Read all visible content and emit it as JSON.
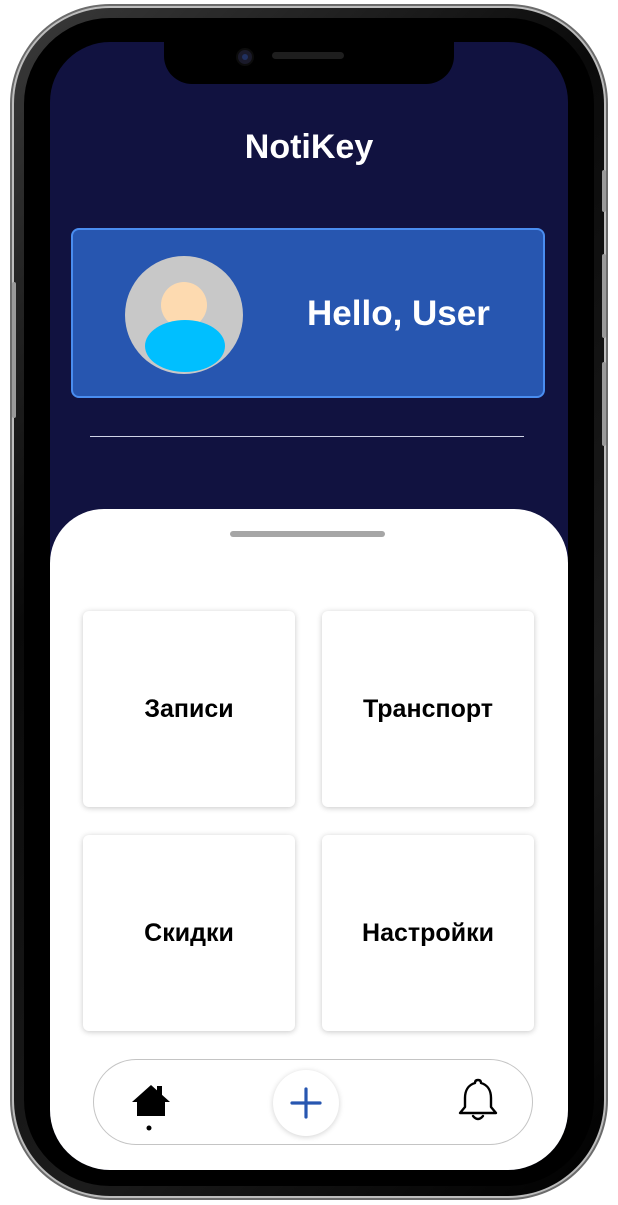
{
  "app": {
    "title": "NotiKey"
  },
  "profile": {
    "greeting": "Hello, User",
    "avatar_icon": "user-avatar-icon"
  },
  "menu": {
    "tiles": [
      {
        "label": "Записи"
      },
      {
        "label": "Транспорт"
      },
      {
        "label": "Скидки"
      },
      {
        "label": "Настройки"
      }
    ]
  },
  "nav": {
    "items": [
      {
        "icon": "home-icon",
        "active": true
      },
      {
        "icon": "plus-icon"
      },
      {
        "icon": "bell-icon"
      }
    ]
  },
  "colors": {
    "background": "#111240",
    "card": "#2756b0",
    "card_border": "#4a8df0",
    "accent": "#2756b0",
    "avatar_body": "#00bfff"
  }
}
